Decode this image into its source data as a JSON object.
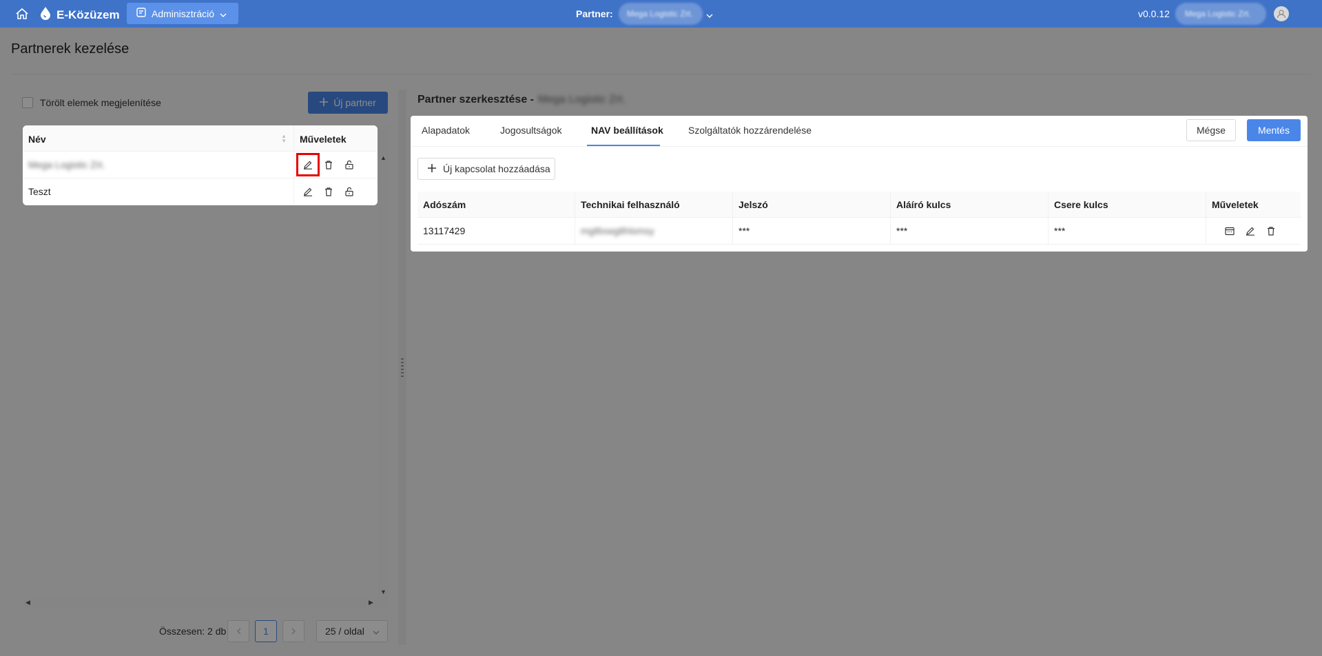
{
  "topbar": {
    "brand": "E-Közüzem",
    "admin_menu_label": "Adminisztráció",
    "partner_label": "Partner:",
    "partner_value": "Mega Logistic Zrt.",
    "version": "v0.0.12",
    "user_name": "Mega Logistic Zrt."
  },
  "page": {
    "title": "Partnerek kezelése"
  },
  "left_panel": {
    "show_deleted_label": "Törölt elemek megjelenítése",
    "new_partner_label": "Új partner",
    "columns": {
      "name": "Név",
      "actions": "Műveletek"
    },
    "rows": [
      {
        "name": "Mega Logistic Zrt."
      },
      {
        "name": "Teszt"
      }
    ],
    "total_label": "Összesen: 2 db",
    "current_page": "1",
    "page_size": "25 / oldal"
  },
  "right_panel": {
    "edit_title": "Partner szerkesztése -",
    "edit_title_partner": "Mega Logistic Zrt.",
    "tabs": [
      {
        "label": "Alapadatok"
      },
      {
        "label": "Jogosultságok"
      },
      {
        "label": "NAV beállítások"
      },
      {
        "label": "Szolgáltatók hozzárendelése"
      }
    ],
    "cancel_label": "Mégse",
    "save_label": "Mentés",
    "add_connection_label": "Új kapcsolat hozzáadása",
    "nav_table": {
      "columns": [
        "Adószám",
        "Technikai felhasználó",
        "Jelszó",
        "Aláíró kulcs",
        "Csere kulcs",
        "Műveletek"
      ],
      "rows": [
        {
          "tax_number": "13117429",
          "technical_user": "mgl8xwg8hlsmsy",
          "password": "***",
          "signing_key": "***",
          "exchange_key": "***"
        }
      ]
    }
  },
  "colors": {
    "topbar": "#3f73c8",
    "primary": "#4a86e8",
    "highlight": "#e60000"
  }
}
